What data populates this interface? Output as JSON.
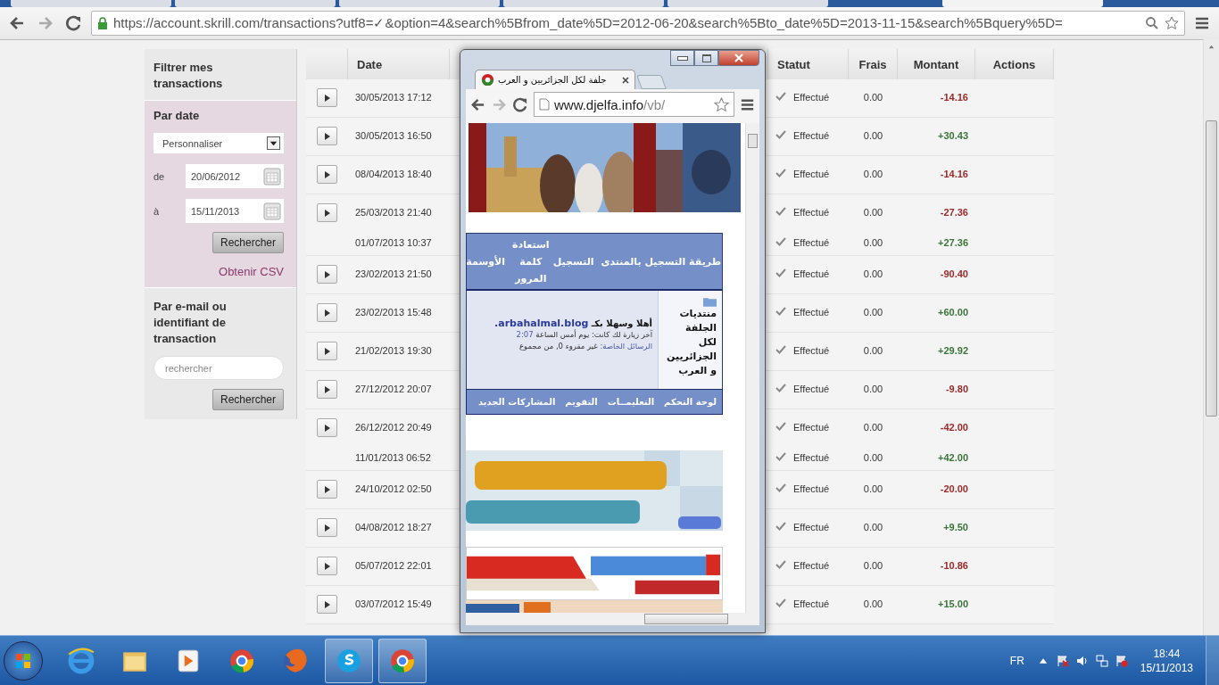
{
  "browser": {
    "tabs": [
      {
        "selected": false
      },
      {
        "selected": false
      },
      {
        "selected": false
      },
      {
        "selected": false
      },
      {
        "selected": false
      },
      {
        "selected": true
      }
    ],
    "url": "https://account.skrill.com/transactions?utf8=✓&option=4&search%5Bfrom_date%5D=2012-06-20&search%5Bto_date%5D=2013-11-15&search%5Bquery%5D="
  },
  "filter": {
    "title": "Filtrer mes transactions",
    "date_section": {
      "title": "Par date",
      "period": "Personnaliser",
      "from_label": "de",
      "from": "20/06/2012",
      "to_label": "à",
      "to": "15/11/2013",
      "button": "Rechercher",
      "csv_link": "Obtenir CSV"
    },
    "query_section": {
      "title": "Par e-mail ou identifiant de transaction",
      "placeholder": "rechercher",
      "button": "Rechercher"
    }
  },
  "table": {
    "columns": [
      "Date",
      "Statut",
      "Frais",
      "Montant",
      "Actions"
    ],
    "rows": [
      {
        "date": "30/05/2013 17:12",
        "status": "Effectué",
        "fee": "0.00",
        "amount": "-14.16",
        "kind": "debit",
        "expandable": true
      },
      {
        "date": "30/05/2013 16:50",
        "status": "Effectué",
        "fee": "0.00",
        "amount": "+30.43",
        "kind": "credit",
        "expandable": true
      },
      {
        "date": "08/04/2013 18:40",
        "status": "Effectué",
        "fee": "0.00",
        "amount": "-14.16",
        "kind": "debit",
        "expandable": true
      },
      {
        "date": "25/03/2013 21:40",
        "status": "Effectué",
        "fee": "0.00",
        "amount": "-27.36",
        "kind": "debit",
        "expandable": true
      },
      {
        "date": "01/07/2013 10:37",
        "status": "Effectué",
        "fee": "0.00",
        "amount": "+27.36",
        "kind": "credit",
        "expandable": false
      },
      {
        "date": "23/02/2013 21:50",
        "status": "Effectué",
        "fee": "0.00",
        "amount": "-90.40",
        "kind": "debit",
        "expandable": true
      },
      {
        "date": "23/02/2013 15:48",
        "status": "Effectué",
        "fee": "0.00",
        "amount": "+60.00",
        "kind": "credit",
        "expandable": true
      },
      {
        "date": "21/02/2013 19:30",
        "status": "Effectué",
        "fee": "0.00",
        "amount": "+29.92",
        "kind": "credit",
        "expandable": true
      },
      {
        "date": "27/12/2012 20:07",
        "status": "Effectué",
        "fee": "0.00",
        "amount": "-9.80",
        "kind": "debit",
        "expandable": true
      },
      {
        "date": "26/12/2012 20:49",
        "status": "Effectué",
        "fee": "0.00",
        "amount": "-42.00",
        "kind": "debit",
        "expandable": true
      },
      {
        "date": "11/01/2013 06:52",
        "status": "Effectué",
        "fee": "0.00",
        "amount": "+42.00",
        "kind": "credit",
        "expandable": false
      },
      {
        "date": "24/10/2012 02:50",
        "status": "Effectué",
        "fee": "0.00",
        "amount": "-20.00",
        "kind": "debit",
        "expandable": true
      },
      {
        "date": "04/08/2012 18:27",
        "status": "Effectué",
        "fee": "0.00",
        "amount": "+9.50",
        "kind": "credit",
        "expandable": true
      },
      {
        "date": "05/07/2012 22:01",
        "status": "Effectué",
        "fee": "0.00",
        "amount": "-10.86",
        "kind": "debit",
        "expandable": true
      },
      {
        "date": "03/07/2012 15:49",
        "status": "Effectué",
        "fee": "0.00",
        "amount": "+15.00",
        "kind": "credit",
        "expandable": true
      }
    ]
  },
  "popup": {
    "tab_title": "جلفة لكل الجزائريين و العرب",
    "url_host": "www.djelfa.info",
    "url_path": "/vb/",
    "nav": [
      "طريقة التسجيل بالمنتدى",
      "التسجيل",
      "استعادة كلمة المرور",
      "الأوسمة"
    ],
    "forum_title": "منتديات الجلفة لكل الجزائريين و العرب",
    "welcome": "أهلا وسهلا بكـ",
    "username": "arbahalmal.blog.",
    "last_visit_label": "آخر زيارة لك كانت: يوم أمس الساعة",
    "last_visit_time": "2:07",
    "messages_label": "الرسائل الخاصة:",
    "messages": "غير مقروء 0, من مجموع",
    "subnav": [
      "لوحة التحكم",
      "التعليمــات",
      "التقويم",
      "المشاركات الجديد"
    ]
  },
  "taskbar": {
    "language": "FR",
    "time": "18:44",
    "date": "15/11/2013"
  }
}
